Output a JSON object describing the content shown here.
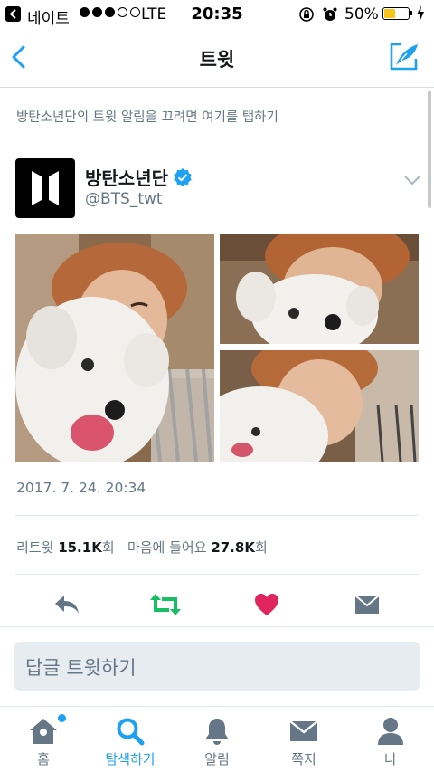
{
  "status_bar": {
    "carrier": "네이트",
    "network": "LTE",
    "time": "20:35",
    "battery_text": "50%",
    "battery_level": 0.5
  },
  "nav": {
    "title": "트윗"
  },
  "notice": "방탄소년단의 트윗 알림을 끄려면 여기를 탭하기",
  "tweet": {
    "display_name": "방탄소년단",
    "handle": "@BTS_twt",
    "date": "2017. 7. 24. 20:34",
    "retweet_label": "리트윗",
    "retweet_count": "15.1K",
    "retweet_unit": "회",
    "like_label": "마음에 들어요",
    "like_count": "27.8K",
    "like_unit": "회"
  },
  "reply_placeholder": "답글 트윗하기",
  "tabs": [
    {
      "label": "홈",
      "icon": "home-icon"
    },
    {
      "label": "탐색하기",
      "icon": "search-icon"
    },
    {
      "label": "알림",
      "icon": "bell-icon"
    },
    {
      "label": "쪽지",
      "icon": "envelope-icon"
    },
    {
      "label": "나",
      "icon": "person-icon"
    }
  ],
  "colors": {
    "accent": "#1da1f2",
    "retweet_green": "#17bf63",
    "like_red": "#e0245e",
    "secondary_text": "#657786"
  }
}
